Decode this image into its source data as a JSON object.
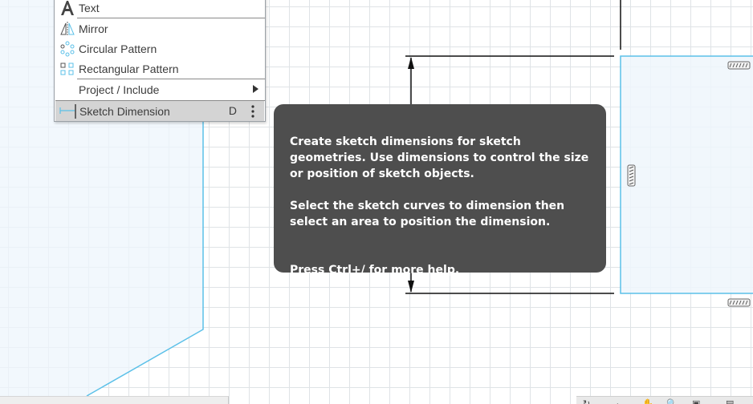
{
  "menu": {
    "items": [
      {
        "label": "Text",
        "icon": "text-icon"
      },
      {
        "label": "Mirror",
        "icon": "mirror-icon"
      },
      {
        "label": "Circular Pattern",
        "icon": "circular-pattern-icon"
      },
      {
        "label": "Rectangular Pattern",
        "icon": "rectangular-pattern-icon"
      },
      {
        "label": "Project / Include",
        "icon": "submenu-arrow-icon"
      },
      {
        "label": "Sketch Dimension",
        "icon": "sketch-dimension-icon",
        "shortcut": "D"
      }
    ]
  },
  "tooltip": {
    "paragraph1": "Create sketch dimensions for sketch geometries. Use dimensions to control the size or position of sketch objects.",
    "paragraph2": "Select the sketch curves to dimension then select an area to position the dimension.",
    "paragraph3": "Press Ctrl+/ for more help."
  },
  "colors": {
    "sketch_line": "#5bc0e8",
    "sketch_fill": "#eef6fc",
    "tooltip_bg": "#4e4e4e",
    "grid": "#dfe3e6"
  }
}
